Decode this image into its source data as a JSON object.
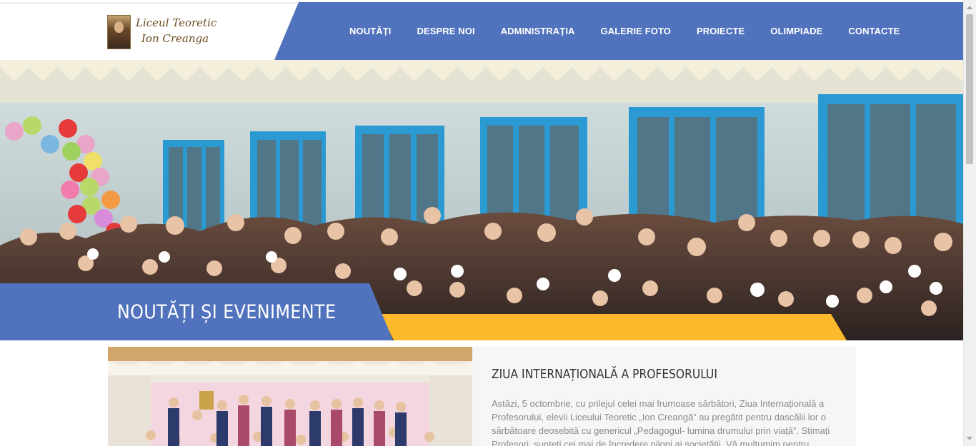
{
  "header": {
    "logo": {
      "line1": "Liceul Teoretic",
      "line2": "Ion Creanga"
    },
    "nav": [
      {
        "label": "NOUTĂȚI"
      },
      {
        "label": "DESPRE NOI"
      },
      {
        "label": "ADMINISTRAȚIA"
      },
      {
        "label": "GALERIE FOTO"
      },
      {
        "label": "PROIECTE"
      },
      {
        "label": "OLIMPIADE"
      },
      {
        "label": "CONTACTE"
      }
    ]
  },
  "hero": {
    "title": "NOUTĂȚI ȘI EVENIMENTE"
  },
  "article": {
    "title": "ZIUA INTERNAȚIONALĂ A PROFESORULUI",
    "text": "Astăzi, 5 octombrie, cu prilejul celei mai frumoase sărbători, Ziua Internațională a Profesorului, elevii Liceului Teoretic „Ion Creangă” au pregătit pentru dascălii lor o sărbătoare deosebită cu genericul „Pedagogul- lumina drumului prin viață”. Stimați Profesori, sunteți cei mai de încredere piloni ai societății. Vă mulțumim pentru"
  },
  "colors": {
    "nav_blue": "#5173bd",
    "accent_yellow": "#fdb92c",
    "article_bg": "#f6f6f6",
    "logo_brown": "#6d4a1f"
  }
}
